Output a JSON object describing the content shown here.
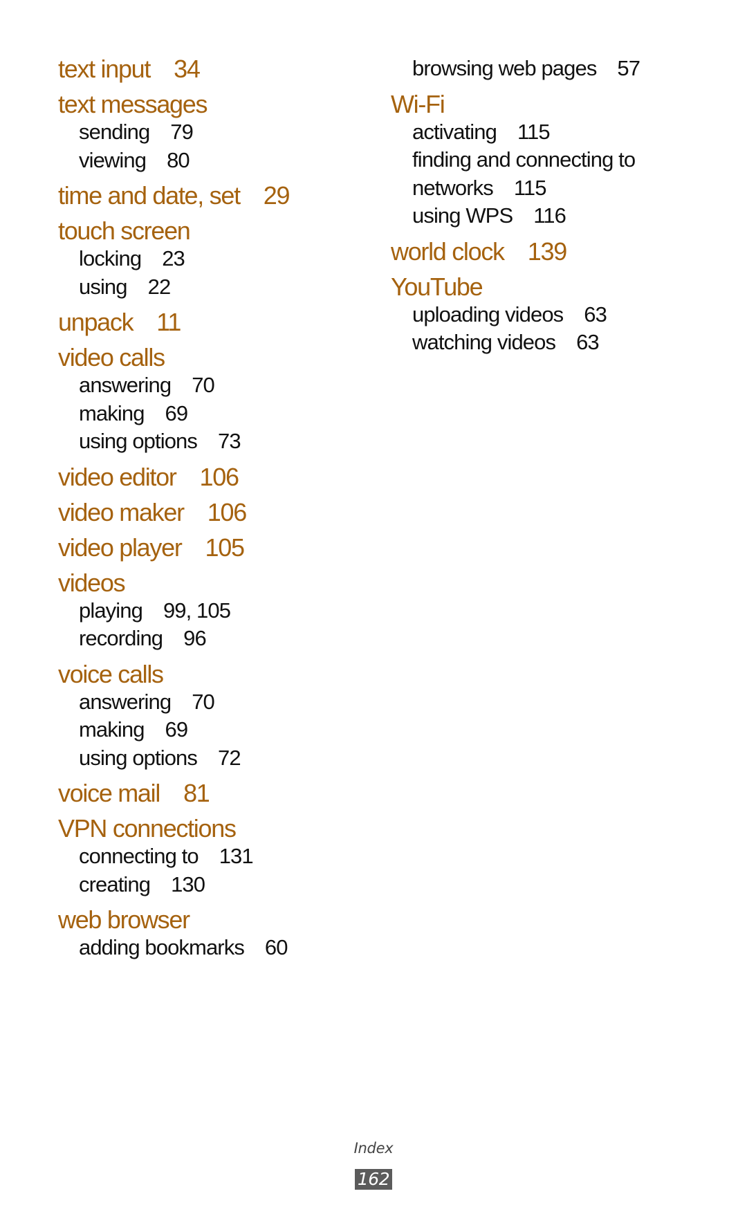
{
  "colors": {
    "heading": "#A5620F",
    "subentry": "#111111",
    "page_box": "#5b5b5b"
  },
  "left_column": [
    {
      "term": "text input",
      "page": "34",
      "subs": []
    },
    {
      "term": "text messages",
      "page": "",
      "subs": [
        {
          "label": "sending",
          "page": "79"
        },
        {
          "label": "viewing",
          "page": "80"
        }
      ]
    },
    {
      "term": "time and date, set",
      "page": "29",
      "subs": []
    },
    {
      "term": "touch screen",
      "page": "",
      "subs": [
        {
          "label": "locking",
          "page": "23"
        },
        {
          "label": "using",
          "page": "22"
        }
      ]
    },
    {
      "term": "unpack",
      "page": "11",
      "subs": []
    },
    {
      "term": "video calls",
      "page": "",
      "subs": [
        {
          "label": "answering",
          "page": "70"
        },
        {
          "label": "making",
          "page": "69"
        },
        {
          "label": "using options",
          "page": "73"
        }
      ]
    },
    {
      "term": "video editor",
      "page": "106",
      "subs": []
    },
    {
      "term": "video maker",
      "page": "106",
      "subs": []
    },
    {
      "term": "video player",
      "page": "105",
      "subs": []
    },
    {
      "term": "videos",
      "page": "",
      "subs": [
        {
          "label": "playing",
          "page": "99, 105"
        },
        {
          "label": "recording",
          "page": "96"
        }
      ]
    },
    {
      "term": "voice calls",
      "page": "",
      "subs": [
        {
          "label": "answering",
          "page": "70"
        },
        {
          "label": "making",
          "page": "69"
        },
        {
          "label": "using options",
          "page": "72"
        }
      ]
    },
    {
      "term": "voice mail",
      "page": "81",
      "subs": []
    },
    {
      "term": "VPN connections",
      "page": "",
      "subs": [
        {
          "label": "connecting to",
          "page": "131"
        },
        {
          "label": "creating",
          "page": "130"
        }
      ]
    },
    {
      "term": "web browser",
      "page": "",
      "subs": [
        {
          "label": "adding bookmarks",
          "page": "60"
        }
      ]
    }
  ],
  "right_column": {
    "continued_subs": [
      {
        "label": "browsing web pages",
        "page": "57"
      }
    ],
    "entries": [
      {
        "term": "Wi-Fi",
        "page": "",
        "subs": [
          {
            "label": "activating",
            "page": "115"
          },
          {
            "label": "finding and connecting to",
            "continuation": "networks",
            "page": "115"
          },
          {
            "label": "using WPS",
            "page": "116"
          }
        ]
      },
      {
        "term": "world clock",
        "page": "139",
        "subs": []
      },
      {
        "term": "YouTube",
        "page": "",
        "subs": [
          {
            "label": "uploading videos",
            "page": "63"
          },
          {
            "label": "watching videos",
            "page": "63"
          }
        ]
      }
    ]
  },
  "footer": {
    "section": "Index",
    "page_number": "162"
  }
}
